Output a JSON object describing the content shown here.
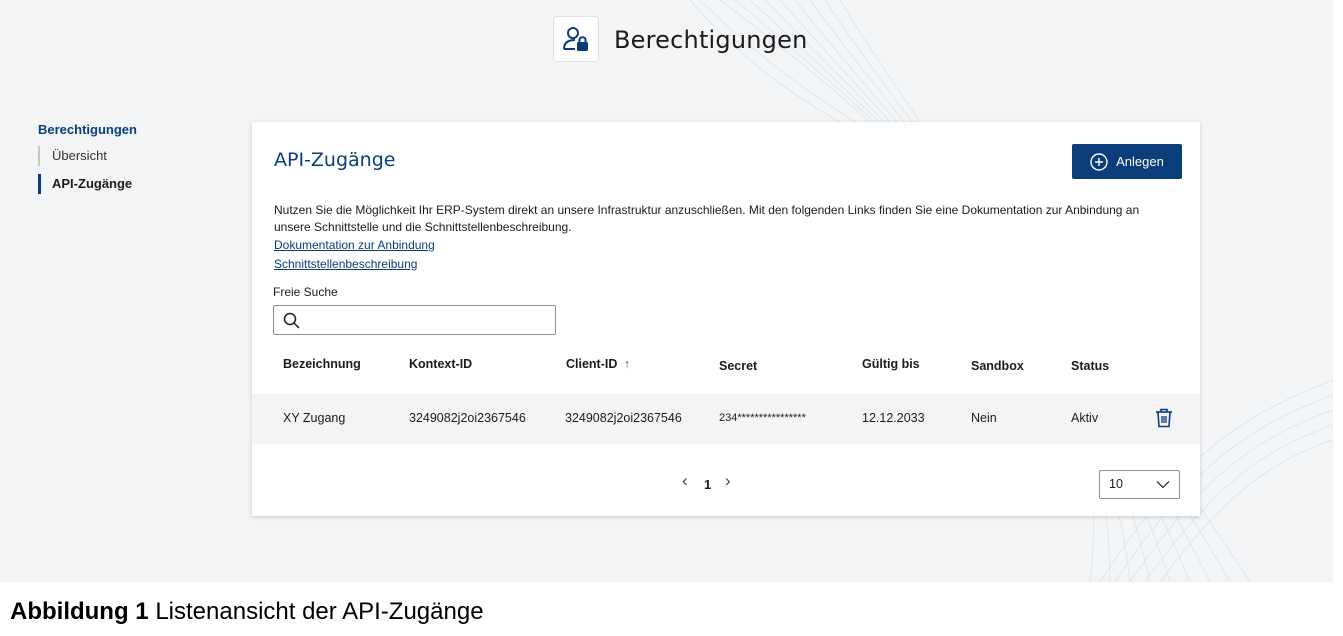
{
  "header": {
    "title": "Berechtigungen",
    "icon": "user-lock-icon"
  },
  "sidebar": {
    "heading": "Berechtigungen",
    "items": [
      {
        "label": "Übersicht",
        "active": false
      },
      {
        "label": "API-Zugänge",
        "active": true
      }
    ]
  },
  "card": {
    "title": "API-Zugänge",
    "create_button_label": "Anlegen",
    "create_button_icon": "plus-circle-icon",
    "intro_text": "Nutzen Sie die Möglichkeit Ihr ERP-System direkt an unsere Infrastruktur anzuschließen. Mit den folgenden Links finden Sie eine Dokumentation zur Anbindung an unsere Schnittstelle und die Schnittstellenbeschreibung.",
    "links": [
      "Dokumentation zur Anbindung",
      "Schnittstellenbeschreibung"
    ]
  },
  "search": {
    "label": "Freie Suche",
    "value": "",
    "placeholder": ""
  },
  "table": {
    "columns": [
      "Bezeichnung",
      "Kontext-ID",
      "Client-ID",
      "Secret",
      "Gültig bis",
      "Sandbox",
      "Status"
    ],
    "sort_column": "Client-ID",
    "sort_direction": "ascending",
    "sort_indicator": "↑",
    "rows": [
      {
        "bezeichnung": "XY Zugang",
        "kontext_id": "3249082j2oi2367546",
        "client_id": "3249082j2oi2367546",
        "secret": "234****************",
        "gueltig_bis": "12.12.2033",
        "sandbox": "Nein",
        "status": "Aktiv"
      }
    ]
  },
  "pagination": {
    "prev": "‹",
    "current_page": "1",
    "next": "›",
    "page_size": "10"
  },
  "caption": {
    "label": "Abbildung 1",
    "text": "Listenansicht der API-Zugänge"
  },
  "colors": {
    "primary": "#0a3d7a",
    "background": "#f3f4f6",
    "row_background": "#f3f4f6"
  }
}
